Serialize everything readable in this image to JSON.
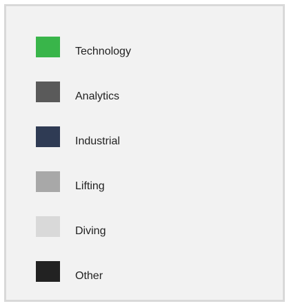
{
  "chart_data": {
    "type": "legend",
    "legend": [
      {
        "label": "Technology",
        "color": "#39b54a"
      },
      {
        "label": "Analytics",
        "color": "#5a5a5a"
      },
      {
        "label": "Industrial",
        "color": "#2f3b54"
      },
      {
        "label": "Lifting",
        "color": "#a8a8a8"
      },
      {
        "label": "Diving",
        "color": "#d9d9d9"
      },
      {
        "label": "Other",
        "color": "#222222"
      }
    ]
  }
}
